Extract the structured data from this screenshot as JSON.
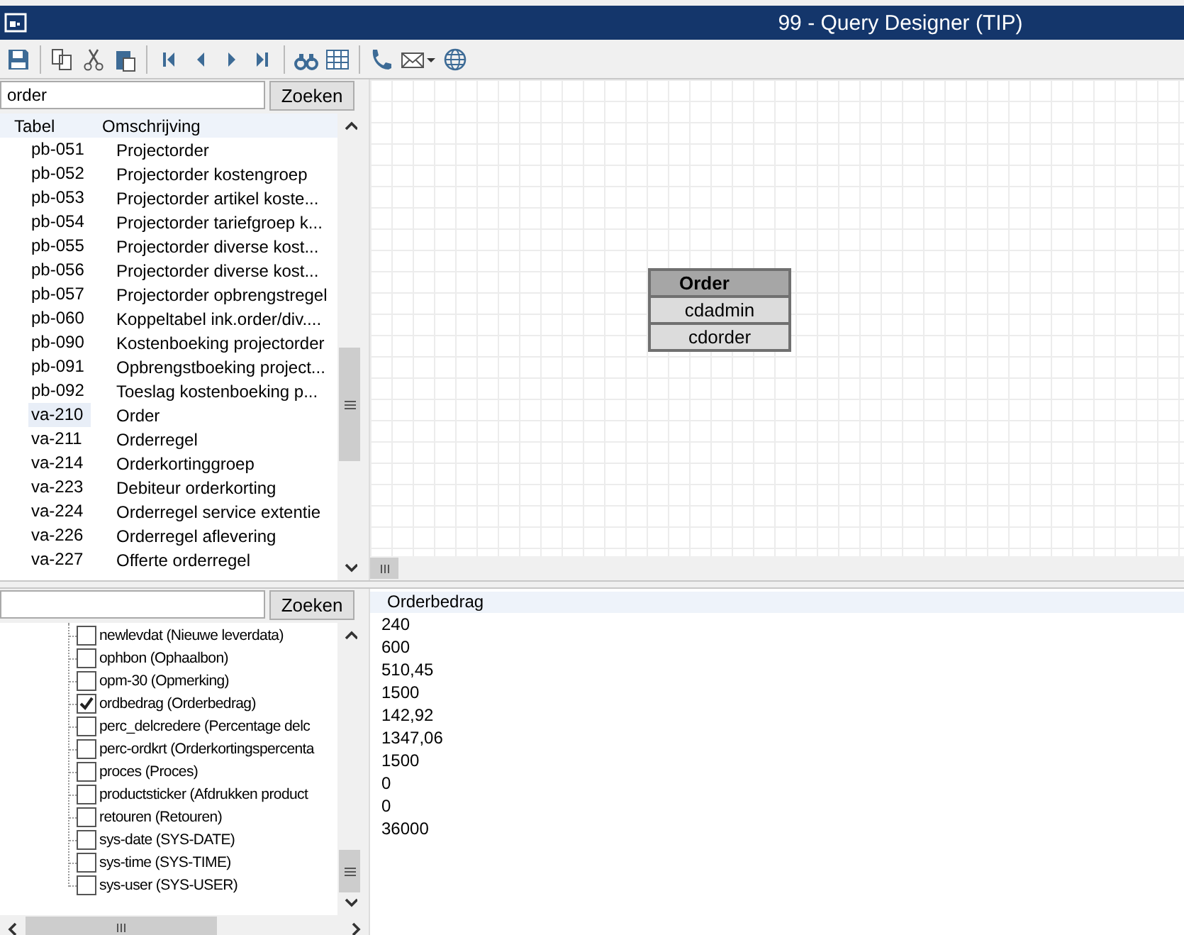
{
  "window": {
    "title": "99 - Query Designer (TIP)"
  },
  "table_search": {
    "value": "order",
    "button": "Zoeken"
  },
  "table_list": {
    "columns": [
      "Tabel",
      "Omschrijving"
    ],
    "rows": [
      {
        "code": "pb-051",
        "description": "Projectorder",
        "selected": false
      },
      {
        "code": "pb-052",
        "description": "Projectorder kostengroep",
        "selected": false
      },
      {
        "code": "pb-053",
        "description": "Projectorder artikel koste...",
        "selected": false
      },
      {
        "code": "pb-054",
        "description": "Projectorder tariefgroep k...",
        "selected": false
      },
      {
        "code": "pb-055",
        "description": "Projectorder diverse kost...",
        "selected": false
      },
      {
        "code": "pb-056",
        "description": "Projectorder diverse kost...",
        "selected": false
      },
      {
        "code": "pb-057",
        "description": "Projectorder opbrengstregel",
        "selected": false
      },
      {
        "code": "pb-060",
        "description": "Koppeltabel ink.order/div....",
        "selected": false
      },
      {
        "code": "pb-090",
        "description": "Kostenboeking projectorder",
        "selected": false
      },
      {
        "code": "pb-091",
        "description": "Opbrengstboeking project...",
        "selected": false
      },
      {
        "code": "pb-092",
        "description": "Toeslag kostenboeking p...",
        "selected": false
      },
      {
        "code": "va-210",
        "description": "Order",
        "selected": true
      },
      {
        "code": "va-211",
        "description": "Orderregel",
        "selected": false
      },
      {
        "code": "va-214",
        "description": "Orderkortinggroep",
        "selected": false
      },
      {
        "code": "va-223",
        "description": "Debiteur orderkorting",
        "selected": false
      },
      {
        "code": "va-224",
        "description": "Orderregel service extentie",
        "selected": false
      },
      {
        "code": "va-226",
        "description": "Orderregel aflevering",
        "selected": false
      },
      {
        "code": "va-227",
        "description": "Offerte orderregel",
        "selected": false
      }
    ]
  },
  "canvas": {
    "entity": {
      "title": "Order",
      "fields": [
        "cdadmin",
        "cdorder"
      ]
    }
  },
  "field_search": {
    "button": "Zoeken"
  },
  "field_tree": [
    {
      "label": "newlevdat (Nieuwe leverdata)",
      "checked": false
    },
    {
      "label": "ophbon (Ophaalbon)",
      "checked": false
    },
    {
      "label": "opm-30 (Opmerking)",
      "checked": false
    },
    {
      "label": "ordbedrag (Orderbedrag)",
      "checked": true
    },
    {
      "label": "perc_delcredere (Percentage delc",
      "checked": false
    },
    {
      "label": "perc-ordkrt (Orderkortingspercenta",
      "checked": false
    },
    {
      "label": "proces (Proces)",
      "checked": false
    },
    {
      "label": "productsticker (Afdrukken product",
      "checked": false
    },
    {
      "label": "retouren (Retouren)",
      "checked": false
    },
    {
      "label": "sys-date (SYS-DATE)",
      "checked": false
    },
    {
      "label": "sys-time (SYS-TIME)",
      "checked": false
    },
    {
      "label": "sys-user (SYS-USER)",
      "checked": false
    }
  ],
  "results": {
    "column": "Orderbedrag",
    "values": [
      "240",
      "600",
      "510,45",
      "1500",
      "142,92",
      "1347,06",
      "1500",
      "0",
      "0",
      "36000"
    ]
  }
}
